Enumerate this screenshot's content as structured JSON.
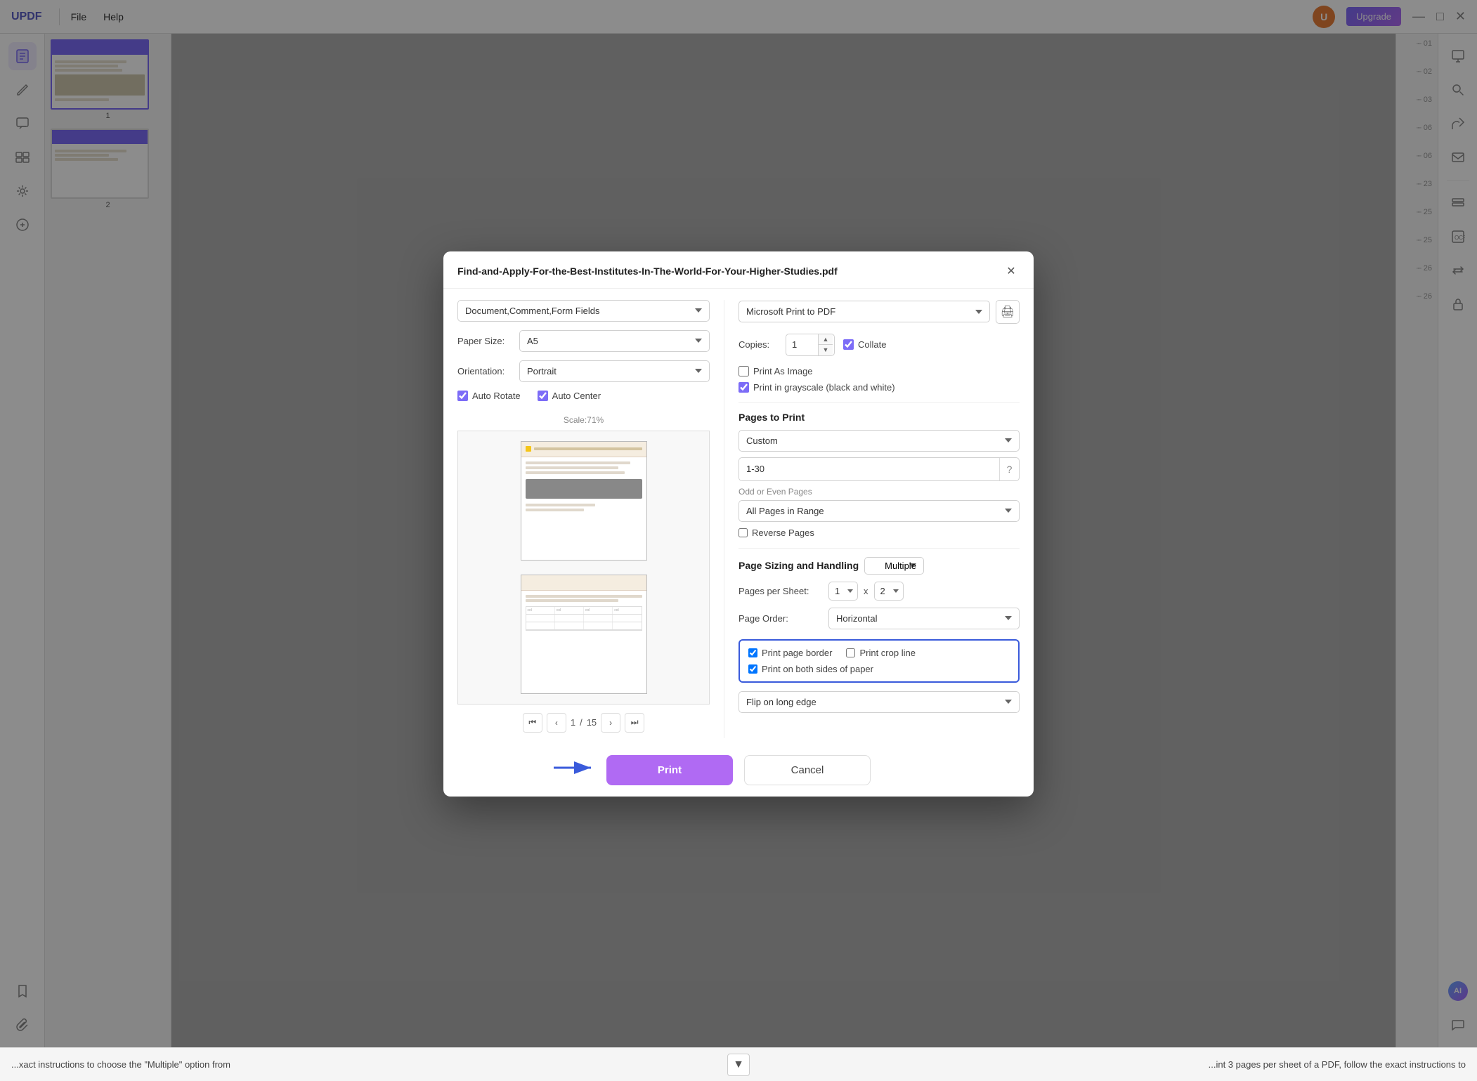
{
  "app": {
    "logo": "UPDF",
    "menu": [
      "File",
      "Help"
    ],
    "upgrade_label": "Upgrade",
    "window_controls": [
      "—",
      "□",
      "✕"
    ]
  },
  "dialog": {
    "title": "Find-and-Apply-For-the-Best-Institutes-In-The-World-For-Your-Higher-Studies.pdf",
    "close_icon": "✕",
    "left_panel": {
      "content_dropdown": "Document,Comment,Form Fields",
      "paper_size_label": "Paper Size:",
      "paper_size_value": "A5",
      "orientation_label": "Orientation:",
      "orientation_value": "Portrait",
      "auto_rotate_label": "Auto Rotate",
      "auto_center_label": "Auto Center",
      "auto_rotate_checked": true,
      "auto_center_checked": true,
      "scale_text": "Scale:71%",
      "page_current": "1",
      "page_separator": "/",
      "page_total": "15"
    },
    "right_panel": {
      "printer_value": "Microsoft Print to PDF",
      "printer_icon": "🖨",
      "copies_label": "Copies:",
      "copies_value": "1",
      "collate_label": "Collate",
      "collate_checked": true,
      "print_as_image_label": "Print As Image",
      "print_as_image_checked": false,
      "print_grayscale_label": "Print in grayscale (black and white)",
      "print_grayscale_checked": true,
      "pages_to_print_title": "Pages to Print",
      "pages_dropdown_value": "Custom",
      "pages_range_value": "1-30",
      "odd_even_label": "Odd or Even Pages",
      "odd_even_value": "All Pages in Range",
      "reverse_pages_label": "Reverse Pages",
      "reverse_pages_checked": false,
      "page_sizing_title": "Page Sizing and Handling",
      "multiple_label": "Multiple",
      "pages_per_sheet_label": "Pages per Sheet:",
      "pages_per_sheet_x": "1",
      "pages_per_sheet_y": "2",
      "page_order_label": "Page Order:",
      "page_order_value": "Horizontal",
      "print_page_border_label": "Print page border",
      "print_page_border_checked": true,
      "print_crop_line_label": "Print crop line",
      "print_crop_line_checked": false,
      "print_both_sides_label": "Print on both sides of paper",
      "print_both_sides_checked": true,
      "flip_edge_label": "Flip on long edge",
      "flip_edge_value": "Flip on long edge"
    },
    "footer": {
      "print_label": "Print",
      "cancel_label": "Cancel"
    }
  },
  "thumbnails": [
    {
      "num": "1",
      "active": true
    },
    {
      "num": "2",
      "active": false
    }
  ],
  "right_numbers": [
    "01",
    "02",
    "03",
    "06",
    "06",
    "23",
    "25",
    "25",
    "26",
    "26"
  ],
  "bottom_bar": {
    "text": "...xact instructions to choose the \"Multiple\" option from",
    "right_text": "...int 3 pages per sheet of a PDF, follow the exact instructions to"
  }
}
